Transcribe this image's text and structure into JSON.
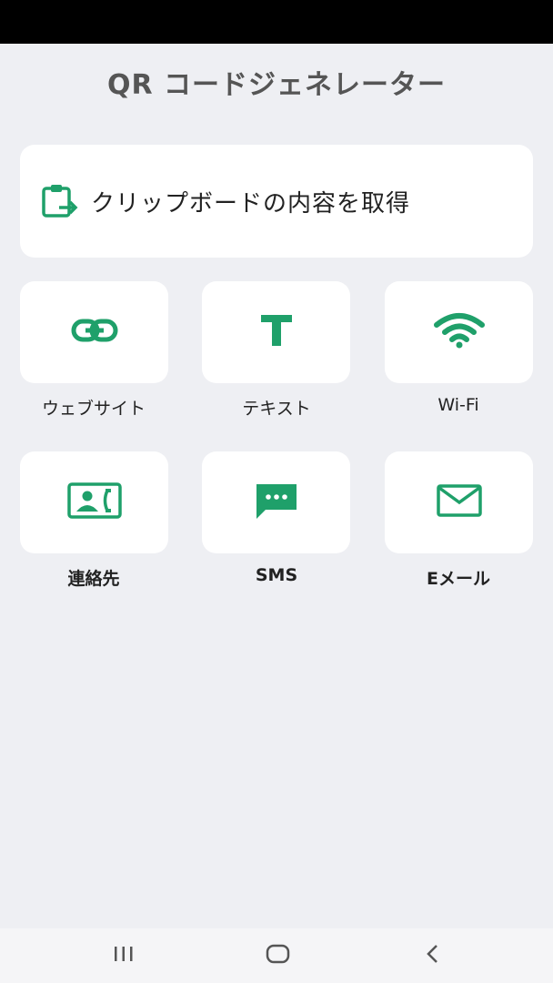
{
  "app": {
    "title": "QR コードジェネレーター"
  },
  "clipboard": {
    "label": "クリップボードの内容を取得",
    "icon": "clipboard-paste-icon"
  },
  "tiles": [
    {
      "label": "ウェブサイト",
      "icon": "link-icon"
    },
    {
      "label": "テキスト",
      "icon": "text-T-icon"
    },
    {
      "label": "Wi-Fi",
      "icon": "wifi-icon"
    },
    {
      "label": "連絡先",
      "icon": "contact-card-icon"
    },
    {
      "label": "SMS",
      "icon": "message-icon"
    },
    {
      "label": "Eメール",
      "icon": "mail-icon"
    }
  ],
  "nav": {
    "recents": "recents-icon",
    "home": "home-icon",
    "back": "back-icon"
  },
  "colors": {
    "accent": "#1fa06a",
    "background": "#eeeff3",
    "card": "#ffffff",
    "title": "#555555"
  }
}
